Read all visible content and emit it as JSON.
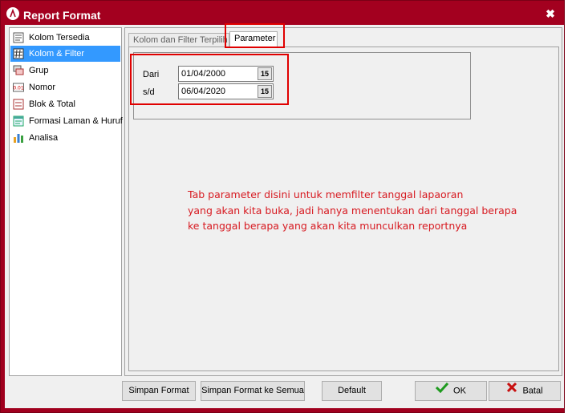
{
  "window": {
    "title": "Report Format",
    "close_glyph": "✖"
  },
  "sidebar": {
    "items": [
      {
        "label": "Kolom Tersedia",
        "icon": "list-icon"
      },
      {
        "label": "Kolom & Filter",
        "icon": "grid-filter-icon",
        "selected": true
      },
      {
        "label": "Grup",
        "icon": "group-icon"
      },
      {
        "label": "Nomor",
        "icon": "number-icon"
      },
      {
        "label": "Blok & Total",
        "icon": "block-total-icon"
      },
      {
        "label": "Formasi Laman & Huruf",
        "icon": "page-format-icon"
      },
      {
        "label": "Analisa",
        "icon": "bar-chart-icon"
      }
    ]
  },
  "tabs": {
    "inactive_label": "Kolom dan Filter Terpilih",
    "active_label": "Parameter"
  },
  "parameter": {
    "from_label": "Dari",
    "from_value": "01/04/2000",
    "to_label": "s/d",
    "to_value": "06/04/2020",
    "calendar_glyph": "15"
  },
  "annotation": {
    "line1": "Tab parameter disini untuk memfilter tanggal lapaoran",
    "line2": "yang akan kita buka, jadi hanya menentukan dari tanggal berapa",
    "line3": "ke tanggal berapa yang akan kita munculkan reportnya",
    "color": "#d71920"
  },
  "buttons": {
    "save_format": "Simpan Format",
    "save_format_all": "Simpan Format ke Semua",
    "default": "Default",
    "ok": "OK",
    "cancel": "Batal"
  },
  "colors": {
    "titlebar": "#a3001f",
    "selection": "#3399ff",
    "highlight_box": "#e00000"
  }
}
